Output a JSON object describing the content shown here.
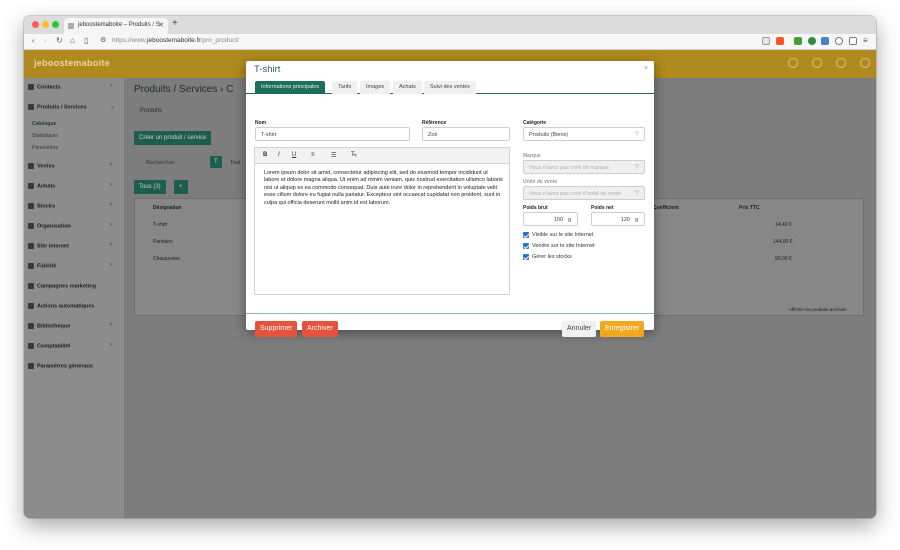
{
  "browser": {
    "tab_title": "jeboostemaboite – Produits / S",
    "tab_close": "✕",
    "new_tab": "+",
    "url_prefix": "https://www.",
    "url_domain": "jeboostemaboite.fr",
    "url_path": "/pro_product/"
  },
  "app": {
    "logo": "jeboostemaboite",
    "sidebar": {
      "items": [
        {
          "label": "Contacts"
        },
        {
          "label": "Produits / Services"
        },
        {
          "label": "Ventes"
        },
        {
          "label": "Achats"
        },
        {
          "label": "Stocks"
        },
        {
          "label": "Organisation"
        },
        {
          "label": "Site internet"
        },
        {
          "label": "Fidélité"
        },
        {
          "label": "Campagnes marketing"
        },
        {
          "label": "Actions automatiques"
        },
        {
          "label": "Bibliothèque"
        },
        {
          "label": "Comptabilité"
        },
        {
          "label": "Paramètres généraux"
        }
      ],
      "subitems": [
        {
          "label": "Catalogue"
        },
        {
          "label": "Statistiques"
        },
        {
          "label": "Paramètres"
        }
      ]
    },
    "main": {
      "page_title": "Produits / Services › C",
      "sub_nav": "Produits",
      "create_button": "Créer un produit / service",
      "search_placeholder": "Rechercher",
      "filter_label": "Tout",
      "tous_tab": "Tous (3)",
      "col_designation": "Désignation",
      "col_coefficient": "Coefficient",
      "col_prix_ttc": "Prix TTC",
      "rows": [
        {
          "name": "T-shirt",
          "price": "14,40 €"
        },
        {
          "name": "Pantalon",
          "price": "144,00 €"
        },
        {
          "name": "Chaussures",
          "price": "90,00 €"
        }
      ],
      "archived_label": "Afficher les produits archivés"
    }
  },
  "modal": {
    "title": "T-shirt",
    "close": "×",
    "tabs": [
      {
        "label": "Informations principales"
      },
      {
        "label": "Tarifs"
      },
      {
        "label": "Images"
      },
      {
        "label": "Achats"
      },
      {
        "label": "Suivi des ventes"
      }
    ],
    "nom_label": "Nom",
    "nom_value": "T-shirt",
    "reference_label": "Référence",
    "reference_value": "Zoé",
    "categorie_label": "Catégorie",
    "categorie_value": "Produits (Biens)",
    "marque_label": "Marque",
    "marque_placeholder": "Vous n'avez pas créé de marque",
    "unite_label": "Unité de vente",
    "unite_placeholder": "Vous n'avez pas créé d'unité de vente",
    "poids_brut_label": "Poids brut",
    "poids_brut_value": "100",
    "poids_net_label": "Poids net",
    "poids_net_value": "120",
    "unit_g": "g",
    "toolbar": {
      "bold": "B",
      "italic": "I",
      "underline": "U",
      "clear": "T̶ₓ"
    },
    "description": "Lorem ipsum dolor sit amet, consectetur adipiscing elit, sed do eiusmod tempor incididunt ut labore et dolore magna aliqua. Ut enim ad minim veniam, quis nostrud exercitation ullamco laboris nisi ut aliquip ex ea commodo consequat. Duis aute irure dolor in reprehenderit in voluptate velit esse cillum dolore eu fugiat nulla pariatur. Excepteur sint occaecat cupidatat non proident, sunt in culpa qui officia deserunt mollit anim id est laborum.",
    "checkboxes": [
      {
        "label": "Visible sur le site Internet",
        "checked": true
      },
      {
        "label": "Vendre sur le site Internet",
        "checked": true
      },
      {
        "label": "Gérer les stocks",
        "checked": true
      }
    ],
    "buttons": {
      "delete": "Supprimer",
      "archive": "Archiver",
      "cancel": "Annuler",
      "save": "Enregistrer"
    }
  },
  "colors": {
    "accent": "#1d6e5c",
    "danger": "#e5533d",
    "save": "#f2a81d",
    "topbar": "#b08a1f"
  }
}
